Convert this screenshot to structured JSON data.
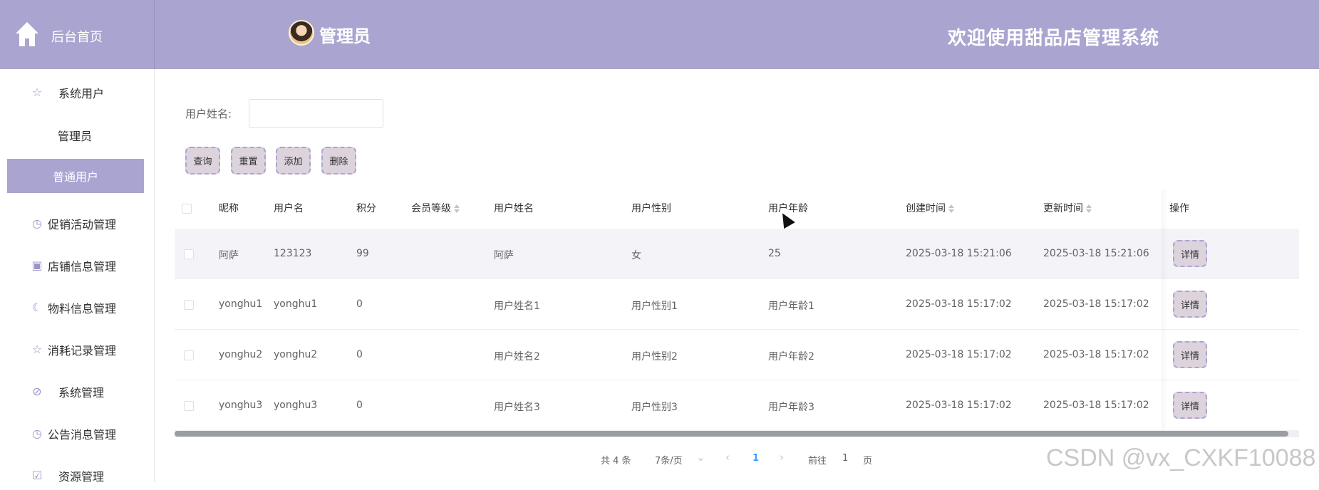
{
  "header": {
    "home_label": "后台首页",
    "admin_name": "管理员",
    "welcome": "欢迎使用甜品店管理系统"
  },
  "sidebar": {
    "items": [
      {
        "label": "系统用户",
        "icon": "star-icon"
      },
      {
        "label": "管理员",
        "icon": ""
      },
      {
        "label": "普通用户",
        "icon": "",
        "active": true
      },
      {
        "label": "促销活动管理",
        "icon": "clock-icon"
      },
      {
        "label": "店铺信息管理",
        "icon": "calendar-icon"
      },
      {
        "label": "物料信息管理",
        "icon": "moon-icon"
      },
      {
        "label": "消耗记录管理",
        "icon": "star-icon"
      },
      {
        "label": "系统管理",
        "icon": "compass-icon"
      },
      {
        "label": "公告消息管理",
        "icon": "clock-icon"
      },
      {
        "label": "资源管理",
        "icon": "calendar-check-icon"
      }
    ]
  },
  "search": {
    "label": "用户姓名:",
    "value": "",
    "placeholder": ""
  },
  "toolbar": {
    "query": "查询",
    "reset": "重置",
    "add": "添加",
    "delete": "删除"
  },
  "table": {
    "columns": [
      "昵称",
      "用户名",
      "积分",
      "会员等级",
      "用户姓名",
      "用户性别",
      "用户年龄",
      "创建时间",
      "更新时间",
      "操作"
    ],
    "rows": [
      {
        "nickname": "阿萨",
        "username": "123123",
        "points": "99",
        "level": "",
        "realname": "阿萨",
        "gender": "女",
        "age": "25",
        "created": "2025-03-18 15:21:06",
        "updated": "2025-03-18 15:21:06",
        "action": "详情"
      },
      {
        "nickname": "yonghu1",
        "username": "yonghu1",
        "points": "0",
        "level": "",
        "realname": "用户姓名1",
        "gender": "用户性别1",
        "age": "用户年龄1",
        "created": "2025-03-18 15:17:02",
        "updated": "2025-03-18 15:17:02",
        "action": "详情"
      },
      {
        "nickname": "yonghu2",
        "username": "yonghu2",
        "points": "0",
        "level": "",
        "realname": "用户姓名2",
        "gender": "用户性别2",
        "age": "用户年龄2",
        "created": "2025-03-18 15:17:02",
        "updated": "2025-03-18 15:17:02",
        "action": "详情"
      },
      {
        "nickname": "yonghu3",
        "username": "yonghu3",
        "points": "0",
        "level": "",
        "realname": "用户姓名3",
        "gender": "用户性别3",
        "age": "用户年龄3",
        "created": "2025-03-18 15:17:02",
        "updated": "2025-03-18 15:17:02",
        "action": "详情"
      }
    ]
  },
  "pagination": {
    "total": "共 4 条",
    "page_size": "7条/页",
    "current_page": "1",
    "goto_prefix": "前往",
    "goto_value": "1",
    "goto_suffix": "页"
  },
  "watermark": "CSDN @vx_CXKF10088",
  "colors": {
    "accent": "#aaa5d0",
    "button_bg": "#ddd3dc",
    "page_active": "#409eff"
  }
}
